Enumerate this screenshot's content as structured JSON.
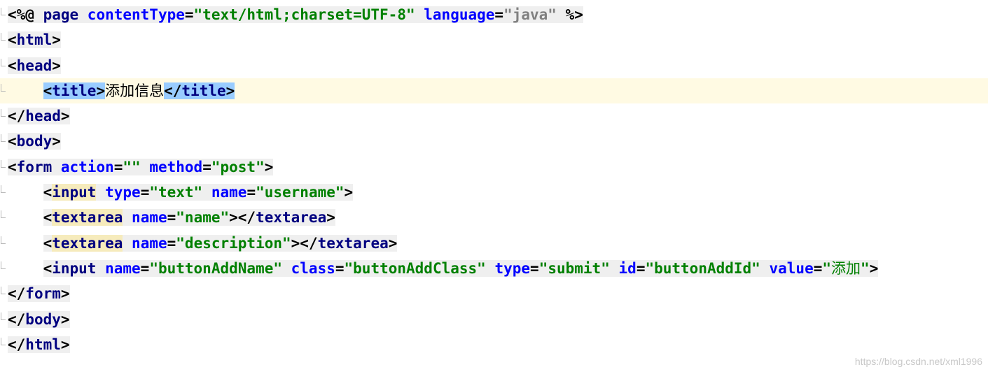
{
  "lines": [
    {
      "current": false,
      "tokens": [
        {
          "t": "<%@ ",
          "c": "plain"
        },
        {
          "t": "page ",
          "c": "tag"
        },
        {
          "t": "contentType",
          "c": "attr"
        },
        {
          "t": "=",
          "c": "plain"
        },
        {
          "t": "\"text/html;charset=UTF-8\"",
          "c": "str"
        },
        {
          "t": " ",
          "c": "plain"
        },
        {
          "t": "language",
          "c": "attr"
        },
        {
          "t": "=",
          "c": "plain"
        },
        {
          "t": "\"java\"",
          "c": "strgray"
        },
        {
          "t": " %>",
          "c": "plain"
        }
      ]
    },
    {
      "current": false,
      "tokens": [
        {
          "t": "<",
          "c": "plain"
        },
        {
          "t": "html",
          "c": "tag"
        },
        {
          "t": ">",
          "c": "plain"
        }
      ]
    },
    {
      "current": false,
      "tokens": [
        {
          "t": "<",
          "c": "plain"
        },
        {
          "t": "head",
          "c": "tag"
        },
        {
          "t": ">",
          "c": "plain"
        }
      ]
    },
    {
      "current": true,
      "indent": "    ",
      "tokens": [
        {
          "t": "<",
          "c": "plain",
          "g": "match"
        },
        {
          "t": "title",
          "c": "tag",
          "g": "match"
        },
        {
          "t": ">",
          "c": "plain",
          "g": "match"
        },
        {
          "t": "添加信息",
          "c": "cjk",
          "g": "none"
        },
        {
          "t": "</",
          "c": "plain",
          "g": "match"
        },
        {
          "t": "title",
          "c": "tag",
          "g": "match"
        },
        {
          "t": ">",
          "c": "plain",
          "g": "match"
        }
      ]
    },
    {
      "current": false,
      "tokens": [
        {
          "t": "</",
          "c": "plain"
        },
        {
          "t": "head",
          "c": "tag"
        },
        {
          "t": ">",
          "c": "plain"
        }
      ]
    },
    {
      "current": false,
      "tokens": [
        {
          "t": "<",
          "c": "plain"
        },
        {
          "t": "body",
          "c": "tag"
        },
        {
          "t": ">",
          "c": "plain"
        }
      ]
    },
    {
      "current": false,
      "tokens": [
        {
          "t": "<",
          "c": "plain"
        },
        {
          "t": "form ",
          "c": "tag"
        },
        {
          "t": "action",
          "c": "attr"
        },
        {
          "t": "=",
          "c": "plain"
        },
        {
          "t": "\"\"",
          "c": "str"
        },
        {
          "t": " ",
          "c": "plain"
        },
        {
          "t": "method",
          "c": "attr"
        },
        {
          "t": "=",
          "c": "plain"
        },
        {
          "t": "\"post\"",
          "c": "str"
        },
        {
          "t": ">",
          "c": "plain"
        }
      ]
    },
    {
      "current": false,
      "indent": "    ",
      "tokens": [
        {
          "t": "<",
          "c": "plain"
        },
        {
          "t": "input",
          "c": "tag",
          "g": "tagname"
        },
        {
          "t": " ",
          "c": "plain"
        },
        {
          "t": "type",
          "c": "attr"
        },
        {
          "t": "=",
          "c": "plain"
        },
        {
          "t": "\"text\"",
          "c": "str"
        },
        {
          "t": " ",
          "c": "plain"
        },
        {
          "t": "name",
          "c": "attr"
        },
        {
          "t": "=",
          "c": "plain"
        },
        {
          "t": "\"username\"",
          "c": "str"
        },
        {
          "t": ">",
          "c": "plain"
        }
      ]
    },
    {
      "current": false,
      "indent": "    ",
      "tokens": [
        {
          "t": "<",
          "c": "plain"
        },
        {
          "t": "textarea",
          "c": "tag",
          "g": "tagname"
        },
        {
          "t": " ",
          "c": "plain"
        },
        {
          "t": "name",
          "c": "attr"
        },
        {
          "t": "=",
          "c": "plain"
        },
        {
          "t": "\"name\"",
          "c": "str"
        },
        {
          "t": "></",
          "c": "plain"
        },
        {
          "t": "textarea",
          "c": "tag"
        },
        {
          "t": ">",
          "c": "plain"
        }
      ]
    },
    {
      "current": false,
      "indent": "    ",
      "tokens": [
        {
          "t": "<",
          "c": "plain"
        },
        {
          "t": "textarea",
          "c": "tag",
          "g": "tagname"
        },
        {
          "t": " ",
          "c": "plain"
        },
        {
          "t": "name",
          "c": "attr"
        },
        {
          "t": "=",
          "c": "plain"
        },
        {
          "t": "\"description\"",
          "c": "str"
        },
        {
          "t": "></",
          "c": "plain"
        },
        {
          "t": "textarea",
          "c": "tag"
        },
        {
          "t": ">",
          "c": "plain"
        }
      ]
    },
    {
      "current": false,
      "indent": "    ",
      "tokens": [
        {
          "t": "<",
          "c": "plain"
        },
        {
          "t": "input ",
          "c": "tag"
        },
        {
          "t": "name",
          "c": "attr"
        },
        {
          "t": "=",
          "c": "plain"
        },
        {
          "t": "\"buttonAddName\"",
          "c": "str"
        },
        {
          "t": " ",
          "c": "plain"
        },
        {
          "t": "class",
          "c": "attr"
        },
        {
          "t": "=",
          "c": "plain"
        },
        {
          "t": "\"buttonAddClass\"",
          "c": "str"
        },
        {
          "t": " ",
          "c": "plain"
        },
        {
          "t": "type",
          "c": "attr"
        },
        {
          "t": "=",
          "c": "plain"
        },
        {
          "t": "\"submit\"",
          "c": "str"
        },
        {
          "t": " ",
          "c": "plain"
        },
        {
          "t": "id",
          "c": "attr"
        },
        {
          "t": "=",
          "c": "plain"
        },
        {
          "t": "\"buttonAddId\"",
          "c": "str"
        },
        {
          "t": " ",
          "c": "plain"
        },
        {
          "t": "value",
          "c": "attr"
        },
        {
          "t": "=",
          "c": "plain"
        },
        {
          "t": "\"",
          "c": "str"
        },
        {
          "t": "添加",
          "c": "cjk-str"
        },
        {
          "t": "\"",
          "c": "str"
        },
        {
          "t": ">",
          "c": "plain"
        }
      ]
    },
    {
      "current": false,
      "tokens": [
        {
          "t": "</",
          "c": "plain"
        },
        {
          "t": "form",
          "c": "tag"
        },
        {
          "t": ">",
          "c": "plain"
        }
      ]
    },
    {
      "current": false,
      "tokens": [
        {
          "t": "</",
          "c": "plain"
        },
        {
          "t": "body",
          "c": "tag"
        },
        {
          "t": ">",
          "c": "plain"
        }
      ]
    },
    {
      "current": false,
      "tokens": [
        {
          "t": "</",
          "c": "plain"
        },
        {
          "t": "html",
          "c": "tag"
        },
        {
          "t": ">",
          "c": "plain"
        }
      ]
    }
  ],
  "watermark": "https://blog.csdn.net/xml1996",
  "colors": {
    "tag": "#000080",
    "attribute": "#0000ff",
    "string": "#008000",
    "string_gray": "#808080",
    "current_line": "#fffae3",
    "line_background": "#efefef",
    "tag_match": "#99ccff",
    "tag_name_highlight": "#f6ebbc"
  }
}
